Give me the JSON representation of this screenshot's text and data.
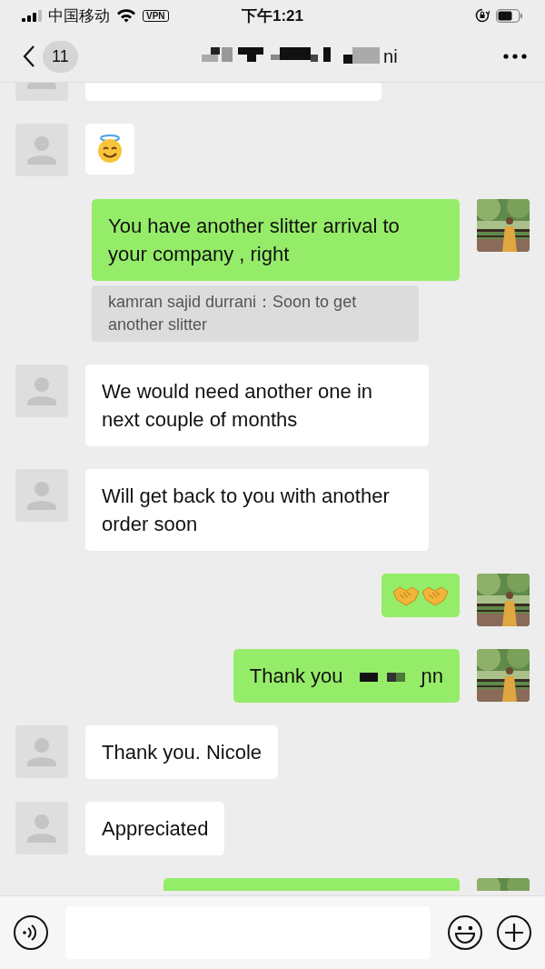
{
  "status_bar": {
    "carrier": "中国移动",
    "vpn": "VPN",
    "time": "下午1:21"
  },
  "header": {
    "back_count": "11",
    "title_visible": "ni"
  },
  "messages": [
    {
      "kind": "cut",
      "sent": false
    },
    {
      "kind": "emoji",
      "sent": false,
      "emojis": [
        {
          "kind": "halo"
        }
      ]
    },
    {
      "kind": "text",
      "sent": true,
      "text": "You have another slitter arrival to your company , right",
      "quote": "kamran sajid durrani：Soon to get another slitter"
    },
    {
      "kind": "text",
      "sent": false,
      "text": "We would need another one in next couple of months"
    },
    {
      "kind": "text",
      "sent": false,
      "text": "Will get back to you with another order soon"
    },
    {
      "kind": "emoji",
      "sent": true,
      "emojis": [
        {
          "kind": "handshake"
        },
        {
          "kind": "handshake"
        }
      ]
    },
    {
      "kind": "redacted",
      "sent": true,
      "text": "Thank you",
      "tail": "ɲn"
    },
    {
      "kind": "text",
      "sent": false,
      "text": "Thank you. Nicole"
    },
    {
      "kind": "text",
      "sent": false,
      "text": "Appreciated"
    },
    {
      "kind": "cut",
      "sent": true
    }
  ]
}
